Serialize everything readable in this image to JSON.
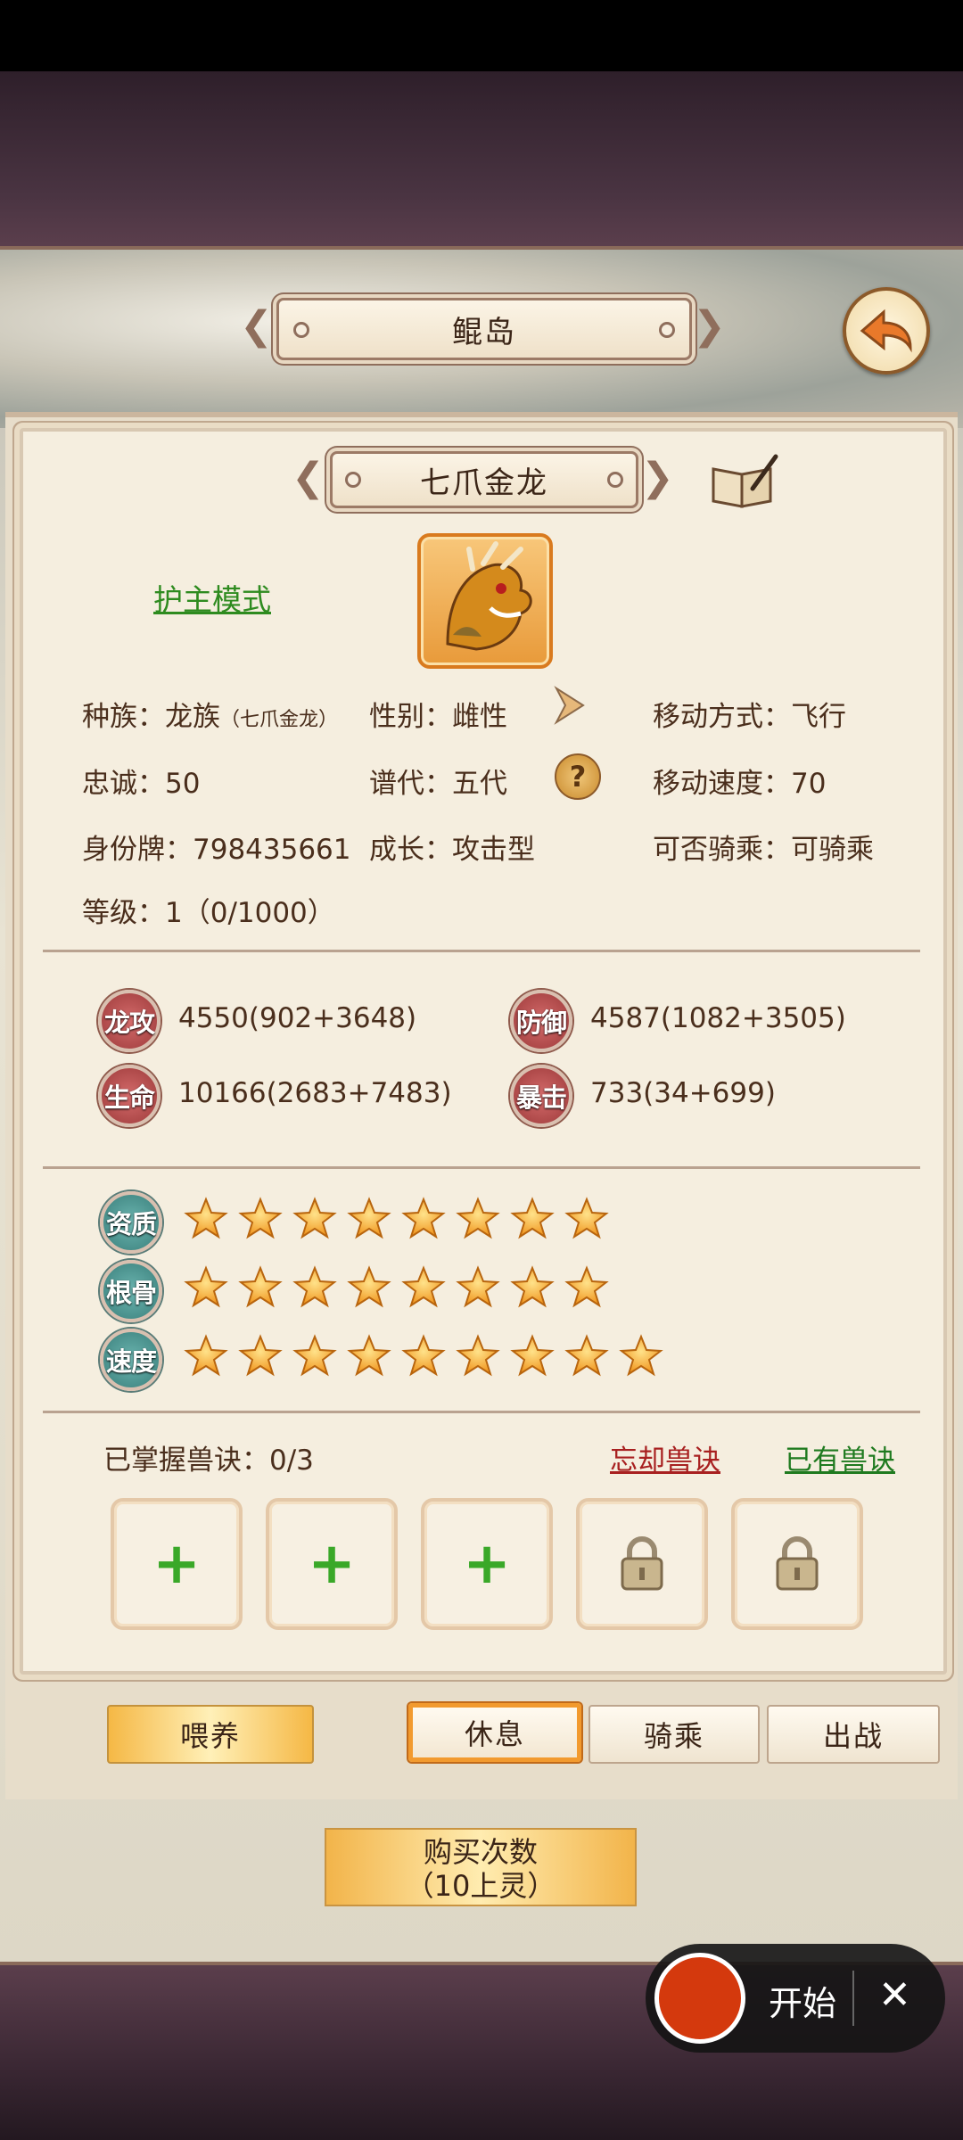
{
  "location_title": "鲲岛",
  "pet": {
    "name": "七爪金龙",
    "mode_link": "护主模式",
    "race_label": "种族：",
    "race_value": "龙族",
    "race_sub": "（七爪金龙）",
    "gender_label": "性别：",
    "gender_value": "雌性",
    "move_label": "移动方式：",
    "move_value": "飞行",
    "loyalty_label": "忠诚：",
    "loyalty_value": "50",
    "gen_label": "谱代：",
    "gen_value": "五代",
    "speed_label": "移动速度：",
    "speed_value": "70",
    "id_label": "身份牌：",
    "id_value": "798435661",
    "growth_label": "成长：",
    "growth_value": "攻击型",
    "ride_label": "可否骑乘：",
    "ride_value": "可骑乘",
    "level_label": "等级：",
    "level_value": "1（0/1000）"
  },
  "stats": [
    {
      "badge": "龙攻",
      "value": "4550(902+3648)"
    },
    {
      "badge": "防御",
      "value": "4587(1082+3505)"
    },
    {
      "badge": "生命",
      "value": "10166(2683+7483)"
    },
    {
      "badge": "暴击",
      "value": "733(34+699)"
    }
  ],
  "ratings": [
    {
      "badge": "资质",
      "stars": 8
    },
    {
      "badge": "根骨",
      "stars": 8
    },
    {
      "badge": "速度",
      "stars": 9
    }
  ],
  "skills": {
    "mastered_label": "已掌握兽诀：",
    "mastered_value": "0/3",
    "forget_link": "忘却兽诀",
    "owned_link": "已有兽诀",
    "slots": [
      "empty",
      "empty",
      "empty",
      "locked",
      "locked"
    ]
  },
  "actions": {
    "feed": "喂养",
    "rest": "休息",
    "ride": "骑乘",
    "battle": "出战"
  },
  "buy": {
    "line1": "购买次数",
    "line2": "（10上灵）"
  },
  "recorder": {
    "start": "开始",
    "close": "✕"
  },
  "colors": {
    "accent_orange": "#f29a2e",
    "link_green": "#2e8b1f",
    "link_red": "#a82020",
    "star_gold": "#f5a623"
  }
}
